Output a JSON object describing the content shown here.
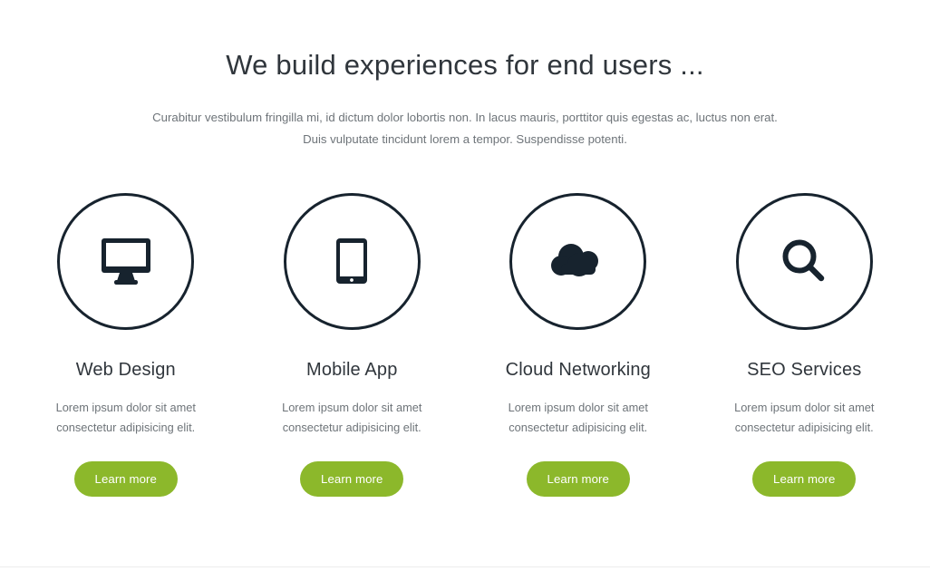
{
  "intro": {
    "heading": "We build experiences for end users ...",
    "subtitle_line1": "Curabitur vestibulum fringilla mi, id dictum dolor lobortis non. In lacus mauris, porttitor quis egestas ac, luctus non erat.",
    "subtitle_line2": "Duis vulputate tincidunt lorem a tempor. Suspendisse potenti."
  },
  "theme": {
    "accent_green": "#8cb82b",
    "ink": "#17232e",
    "heading_color": "#30363c",
    "body_color": "#6e7479",
    "background": "#ffffff"
  },
  "services": [
    {
      "icon": "desktop-monitor-icon",
      "title": "Web Design",
      "description": "Lorem ipsum dolor sit amet consectetur adipisicing elit.",
      "button_label": "Learn more"
    },
    {
      "icon": "tablet-device-icon",
      "title": "Mobile App",
      "description": "Lorem ipsum dolor sit amet consectetur adipisicing elit.",
      "button_label": "Learn more"
    },
    {
      "icon": "cloud-icon",
      "title": "Cloud Networking",
      "description": "Lorem ipsum dolor sit amet consectetur adipisicing elit.",
      "button_label": "Learn more"
    },
    {
      "icon": "search-magnifier-icon",
      "title": "SEO Services",
      "description": "Lorem ipsum dolor sit amet consectetur adipisicing elit.",
      "button_label": "Learn more"
    }
  ]
}
